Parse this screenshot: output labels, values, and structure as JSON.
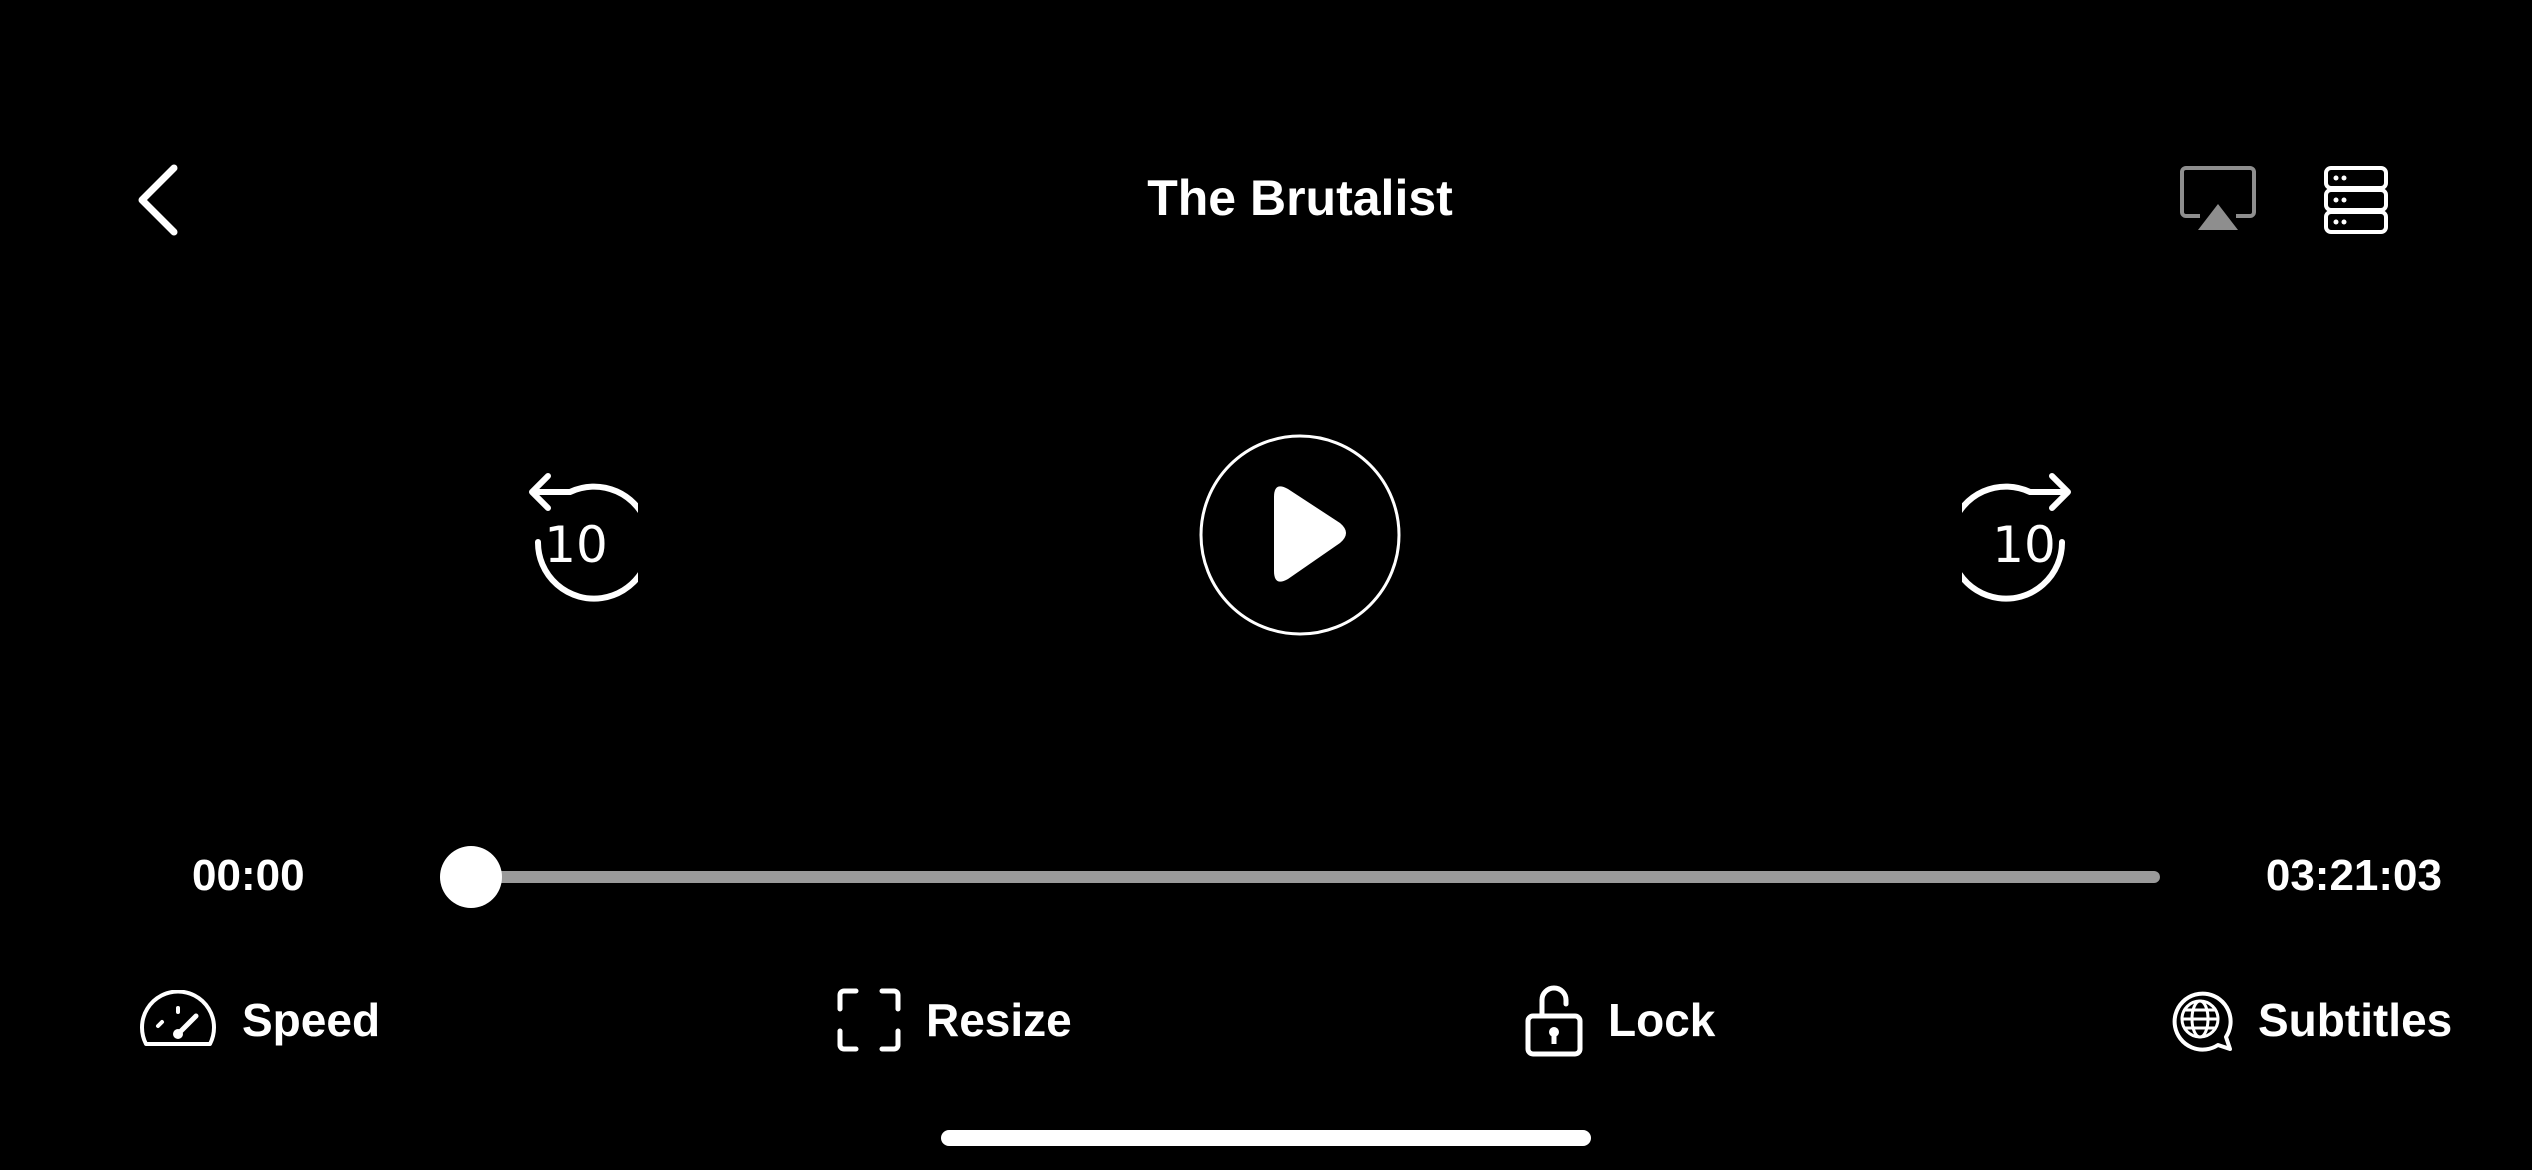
{
  "header": {
    "title": "The Brutalist"
  },
  "controls": {
    "skip_back_label": "10",
    "skip_forward_label": "10"
  },
  "progress": {
    "current_time": "00:00",
    "total_time": "03:21:03",
    "fraction": 0
  },
  "bottom_bar": {
    "speed_label": "Speed",
    "resize_label": "Resize",
    "lock_label": "Lock",
    "subtitles_label": "Subtitles"
  },
  "icons": {
    "back": "chevron-left-icon",
    "airplay": "airplay-icon",
    "episodes": "server-list-icon",
    "play": "play-icon",
    "skip_back": "rotate-ccw-10-icon",
    "skip_forward": "rotate-cw-10-icon",
    "speed": "speedometer-icon",
    "resize": "resize-frame-icon",
    "lock": "unlock-icon",
    "subtitles": "globe-chat-icon"
  },
  "colors": {
    "background": "#000000",
    "foreground": "#ffffff",
    "track": "#9a9a9a",
    "airplay_icon": "#8e8e8e"
  }
}
